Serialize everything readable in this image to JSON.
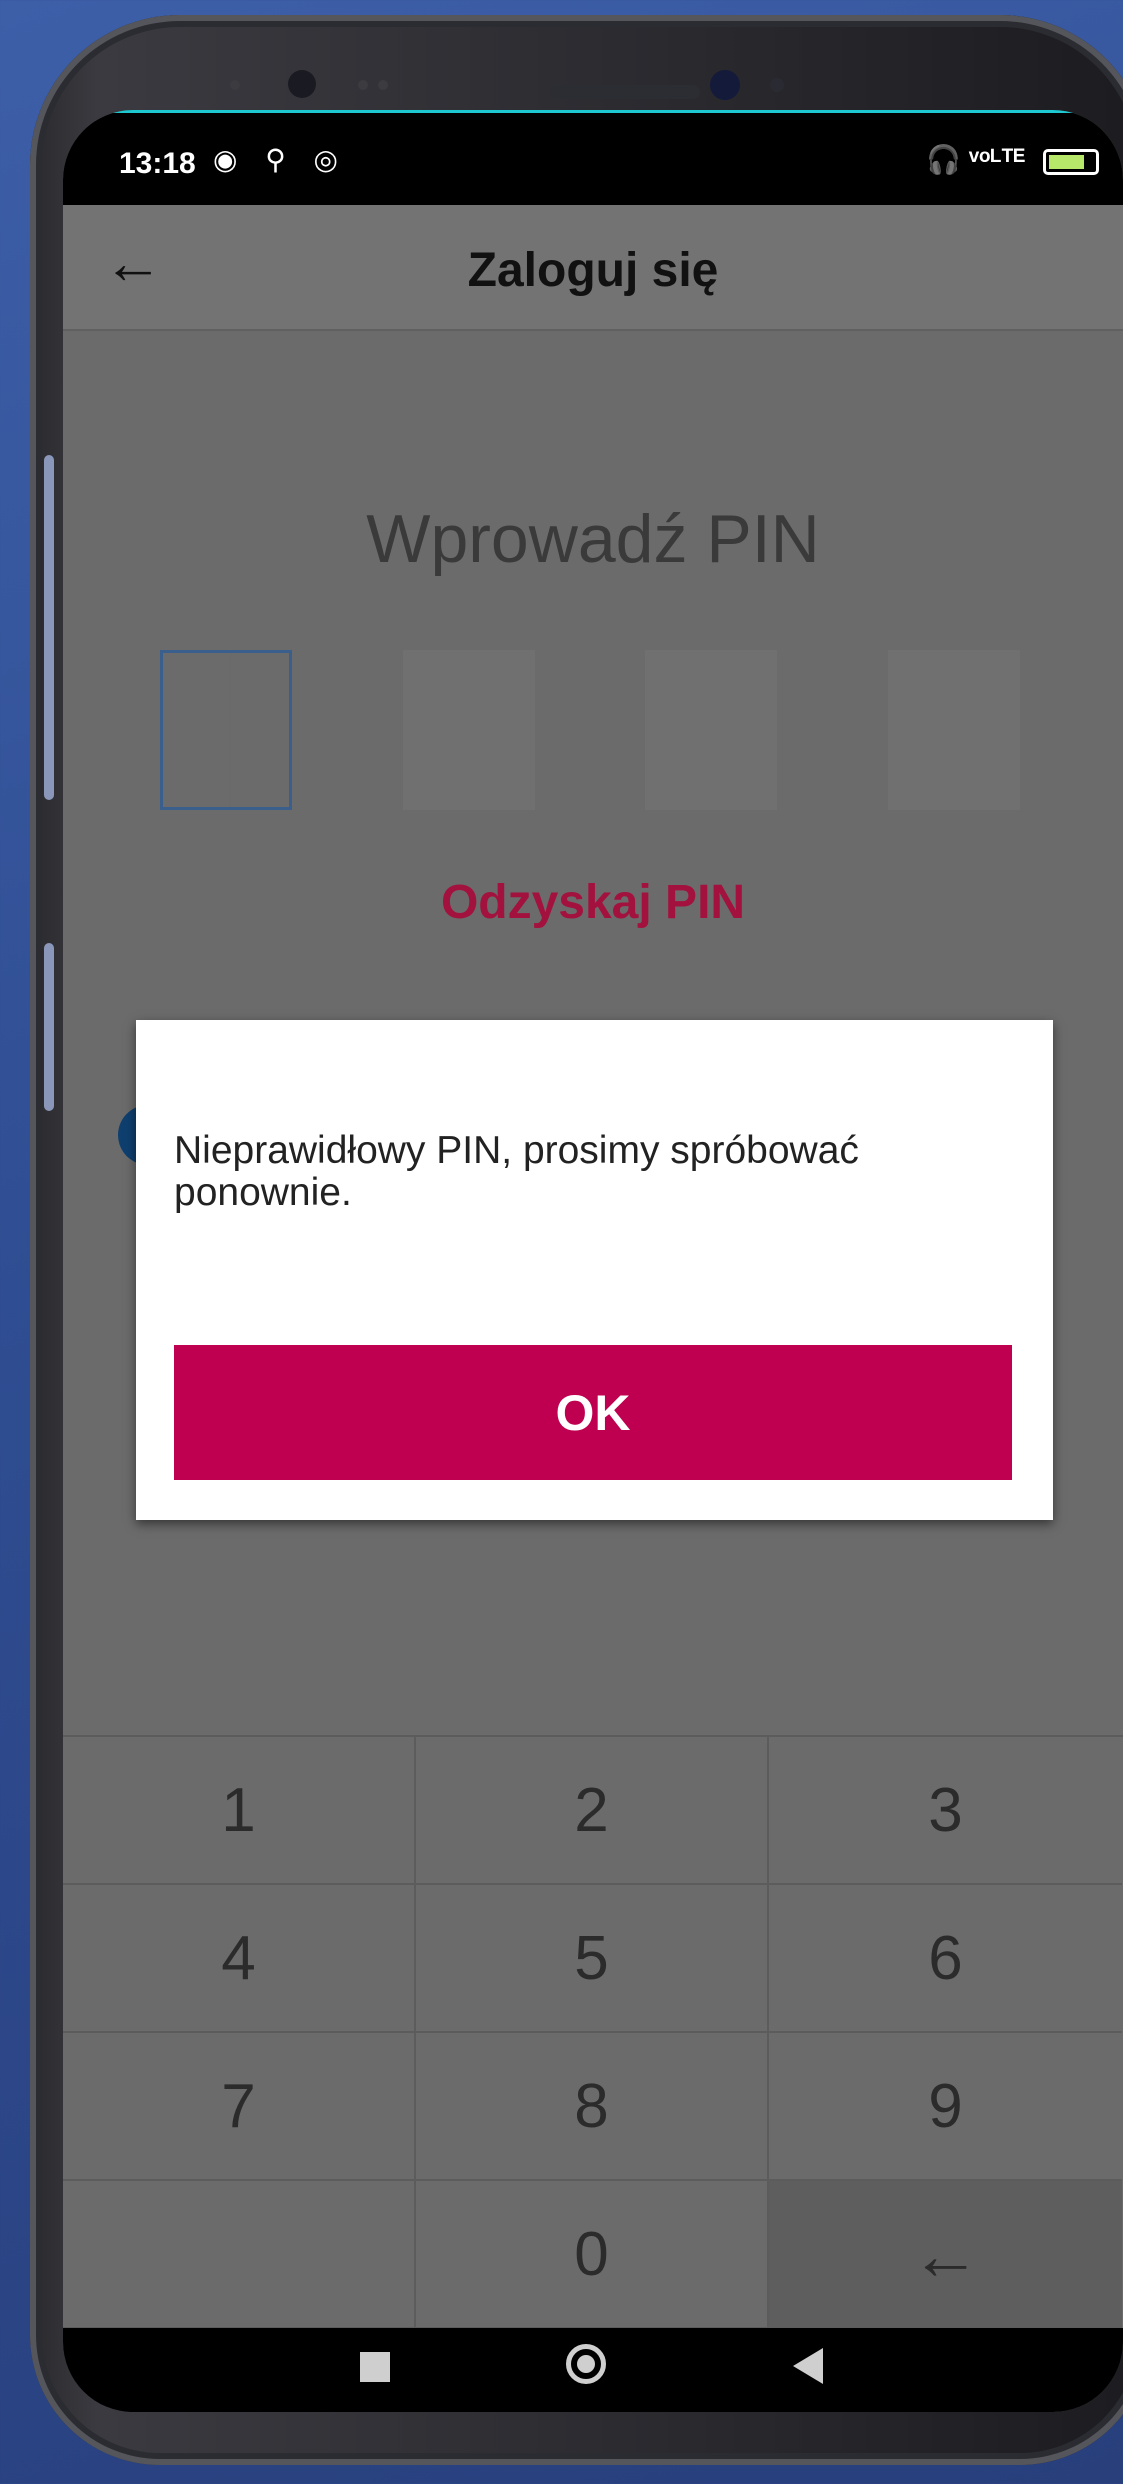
{
  "status_bar": {
    "time": "13:18",
    "left_icons": "◉ ⚲ ◎",
    "right_icons": "🎧 ᵛᵒᴸᵀᴱ"
  },
  "app_bar": {
    "back_icon": "←",
    "title": "Zaloguj się"
  },
  "pin": {
    "title": "Wprowadź PIN",
    "recover_link": "Odzyskaj PIN"
  },
  "dialog": {
    "message": "Nieprawidłowy PIN, prosimy spróbować ponownie.",
    "ok_label": "OK",
    "ok_color": "#bf0050"
  },
  "keypad": {
    "keys": [
      "1",
      "2",
      "3",
      "4",
      "5",
      "6",
      "7",
      "8",
      "9",
      "",
      "0",
      "←"
    ]
  },
  "colors": {
    "accent": "#a3123f",
    "pin_active_border": "#3a5f8c"
  }
}
